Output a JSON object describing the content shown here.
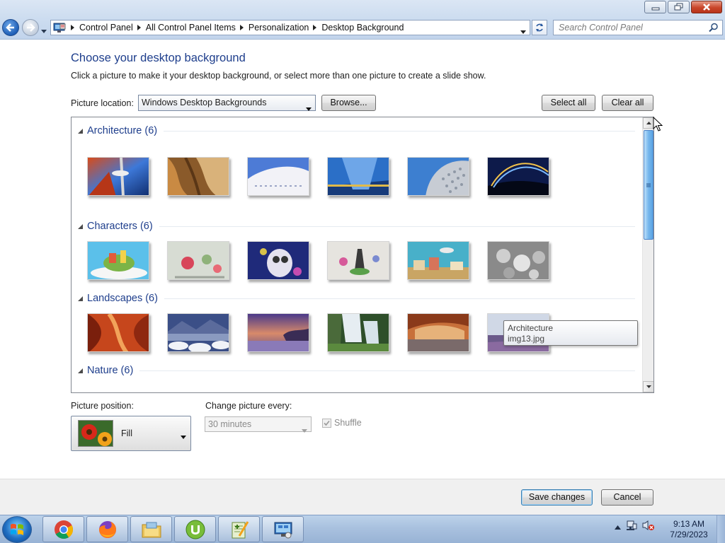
{
  "window": {
    "breadcrumbs": [
      "Control Panel",
      "All Control Panel Items",
      "Personalization",
      "Desktop Background"
    ],
    "search_placeholder": "Search Control Panel"
  },
  "page": {
    "title": "Choose your desktop background",
    "description": "Click a picture to make it your desktop background, or select more than one picture to create a slide show."
  },
  "location": {
    "label": "Picture location:",
    "value": "Windows Desktop Backgrounds",
    "browse_label": "Browse...",
    "select_all_label": "Select all",
    "clear_all_label": "Clear all"
  },
  "groups": [
    {
      "title": "Architecture (6)",
      "thumbs": [
        "architecture-1",
        "architecture-2",
        "architecture-3",
        "architecture-4",
        "architecture-5",
        "architecture-6"
      ]
    },
    {
      "title": "Characters (6)",
      "thumbs": [
        "characters-1",
        "characters-2",
        "characters-3",
        "characters-4",
        "characters-5",
        "characters-6"
      ]
    },
    {
      "title": "Landscapes (6)",
      "thumbs": [
        "landscapes-1",
        "landscapes-2",
        "landscapes-3",
        "landscapes-4",
        "landscapes-5",
        "landscapes-6"
      ]
    },
    {
      "title": "Nature (6)",
      "thumbs": []
    }
  ],
  "tooltip": {
    "line1": "Architecture",
    "line2": "img13.jpg"
  },
  "position": {
    "label": "Picture position:",
    "value": "Fill"
  },
  "interval": {
    "label": "Change picture every:",
    "value": "30 minutes",
    "shuffle_label": "Shuffle",
    "shuffle_checked": true
  },
  "footer": {
    "save_label": "Save changes",
    "cancel_label": "Cancel"
  },
  "taskbar": {
    "items": [
      "chrome-icon",
      "firefox-icon",
      "file-explorer-icon",
      "utorrent-icon",
      "notepad-plus-plus-icon",
      "control-panel-icon"
    ],
    "time": "9:13 AM",
    "date": "7/29/2023"
  },
  "colors": {
    "heading": "#1e3e8c",
    "save_border": "#3c7fb1"
  }
}
